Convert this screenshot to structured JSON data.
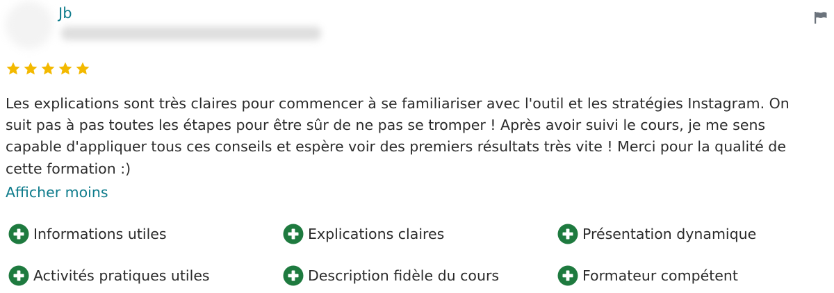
{
  "review": {
    "reviewer_name": "Jb",
    "rating": 5,
    "rating_max": 5,
    "text": "Les explications sont très claires pour commencer à se familiariser avec l'outil et les stratégies Instagram. On suit pas à pas toutes les étapes pour être sûr de ne pas se tromper ! Après avoir suivi le cours, je me sens capable d'appliquer tous ces conseils et espère voir des premiers résultats très vite ! Merci pour la qualité de cette formation :)",
    "toggle_label": "Afficher moins",
    "tags": [
      "Informations utiles",
      "Explications claires",
      "Présentation dynamique",
      "Activités pratiques utiles",
      "Description fidèle du cours",
      "Formateur compétent"
    ]
  },
  "icons": {
    "star": "star-icon",
    "flag": "flag-icon",
    "tag": "plus-circle-icon"
  },
  "colors": {
    "star": "#f3b900",
    "accent_link": "#0f7c8c",
    "tag_icon": "#1e7a3f",
    "flag": "#6b737c",
    "text": "#2b2b2b"
  }
}
